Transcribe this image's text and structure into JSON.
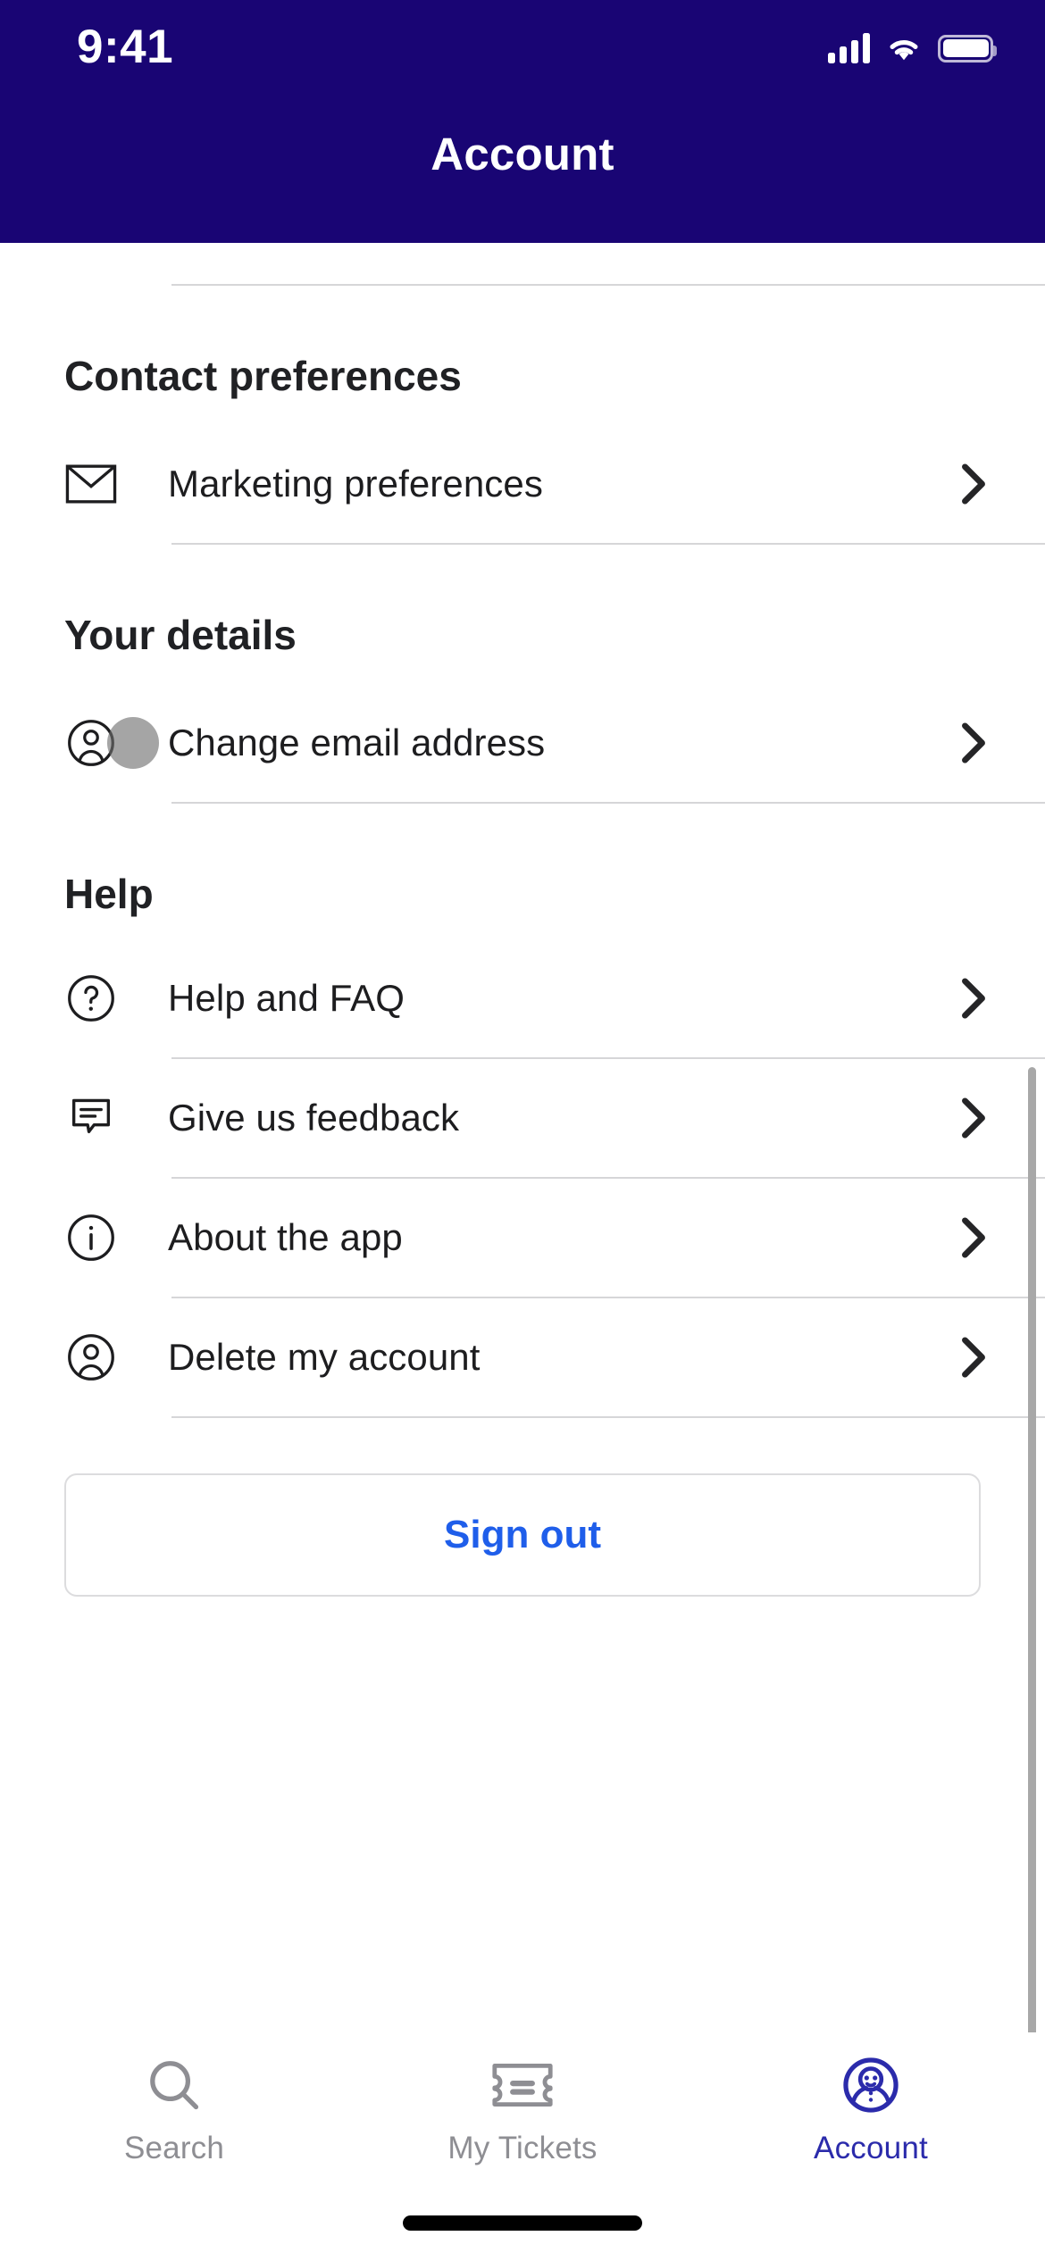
{
  "status_bar": {
    "time": "9:41",
    "signal_icon": "cellular-signal-icon",
    "wifi_icon": "wifi-icon",
    "battery_icon": "battery-icon"
  },
  "header": {
    "title": "Account",
    "background_color": "#190574"
  },
  "sections": [
    {
      "id": "contact-preferences",
      "title": "Contact preferences",
      "rows": [
        {
          "label": "Marketing preferences",
          "icon": "envelope-icon",
          "chevron": "chevron-right-icon"
        }
      ]
    },
    {
      "id": "your-details",
      "title": "Your details",
      "rows": [
        {
          "label": "Change email address",
          "icon": "person-circle-icon",
          "chevron": "chevron-right-icon"
        }
      ]
    },
    {
      "id": "help",
      "title": "Help",
      "rows": [
        {
          "label": "Help and FAQ",
          "icon": "question-circle-icon",
          "chevron": "chevron-right-icon"
        },
        {
          "label": "Give us feedback",
          "icon": "speech-bubble-icon",
          "chevron": "chevron-right-icon"
        },
        {
          "label": "About the app",
          "icon": "info-circle-icon",
          "chevron": "chevron-right-icon"
        },
        {
          "label": "Delete my account",
          "icon": "person-circle-icon",
          "chevron": "chevron-right-icon"
        }
      ]
    }
  ],
  "sign_out": {
    "label": "Sign out",
    "text_color": "#1f5eea",
    "border_color": "#dcdcde"
  },
  "tab_bar": {
    "tabs": [
      {
        "label": "Search",
        "icon": "search-icon",
        "active": false
      },
      {
        "label": "My Tickets",
        "icon": "ticket-icon",
        "active": false
      },
      {
        "label": "Account",
        "icon": "account-face-icon",
        "active": true
      }
    ],
    "active_color": "#2b2bab",
    "inactive_color": "#8e8e93"
  },
  "colors": {
    "brand_indigo": "#190574",
    "accent_blue": "#1f5eea",
    "divider": "#d6d6d8",
    "text_primary": "#1d1d1f"
  }
}
